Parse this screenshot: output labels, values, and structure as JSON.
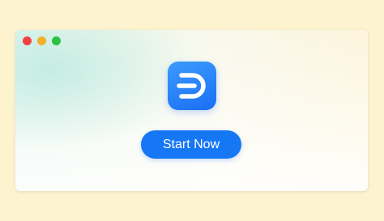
{
  "window": {
    "traffic_lights": [
      "close",
      "minimize",
      "zoom"
    ]
  },
  "app_logo": {
    "icon": "edrawmind-d-logo-icon",
    "color": "#1a6ff2"
  },
  "start_button": {
    "label": "Start Now",
    "color": "#1677f5"
  }
}
